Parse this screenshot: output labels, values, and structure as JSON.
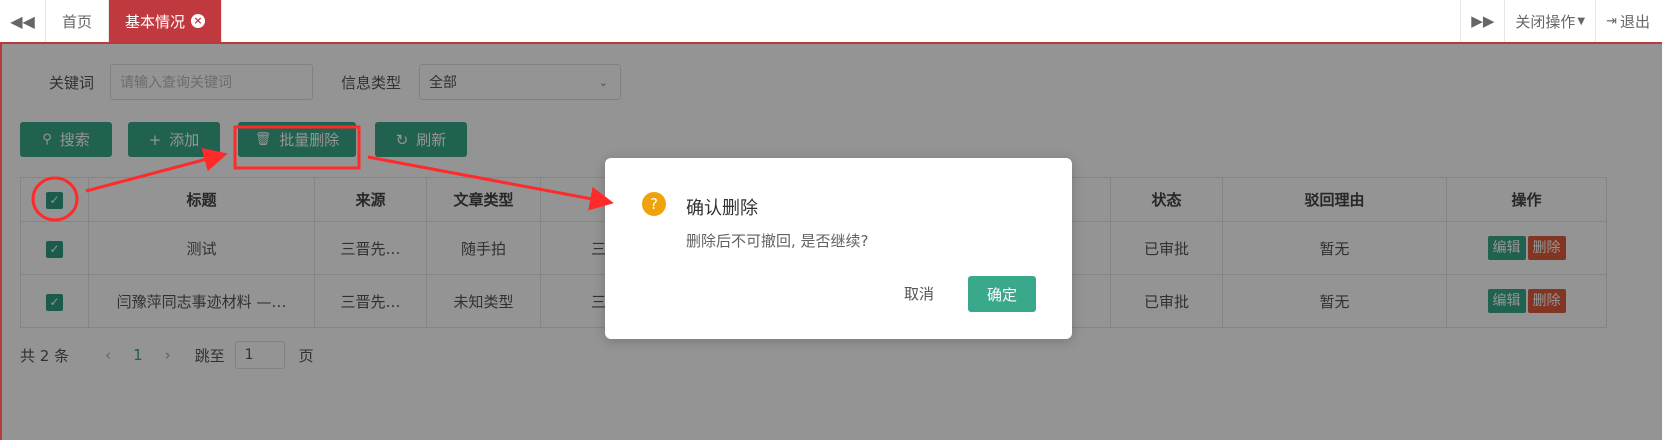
{
  "tabs": {
    "home": "首页",
    "active": "基本情况",
    "close_ops": "关闭操作",
    "logout": "退出"
  },
  "search": {
    "keyword_label": "关键词",
    "keyword_placeholder": "请输入查询关键词",
    "type_label": "信息类型",
    "type_value": "全部"
  },
  "toolbar": {
    "search": "搜索",
    "add": "添加",
    "batch_delete": "批量删除",
    "refresh": "刷新"
  },
  "table": {
    "headers": {
      "title": "标题",
      "source": "来源",
      "type": "文章类型",
      "status": "状态",
      "reason": "驳回理由",
      "ops": "操作"
    },
    "rows": [
      {
        "title": "测试",
        "source": "三晋先…",
        "type": "随手拍",
        "extra": "三",
        "status": "已审批",
        "reason": "暂无",
        "edit": "编辑",
        "delete": "删除"
      },
      {
        "title": "闫豫萍同志事迹材料 —…",
        "source": "三晋先…",
        "type": "未知类型",
        "extra": "三",
        "status": "已审批",
        "reason": "暂无",
        "edit": "编辑",
        "delete": "删除"
      }
    ]
  },
  "pager": {
    "total": "共 2 条",
    "page": "1",
    "goto_label": "跳至",
    "goto_value": "1",
    "page_suffix": "页"
  },
  "dialog": {
    "icon": "?",
    "title": "确认删除",
    "message": "删除后不可撤回, 是否继续?",
    "cancel": "取消",
    "confirm": "确定"
  },
  "colors": {
    "accent": "#3aa88a",
    "tab_active": "#c0393f",
    "danger": "#e05c3d",
    "warning": "#f0a20b",
    "annotation": "#ff2a2a"
  }
}
